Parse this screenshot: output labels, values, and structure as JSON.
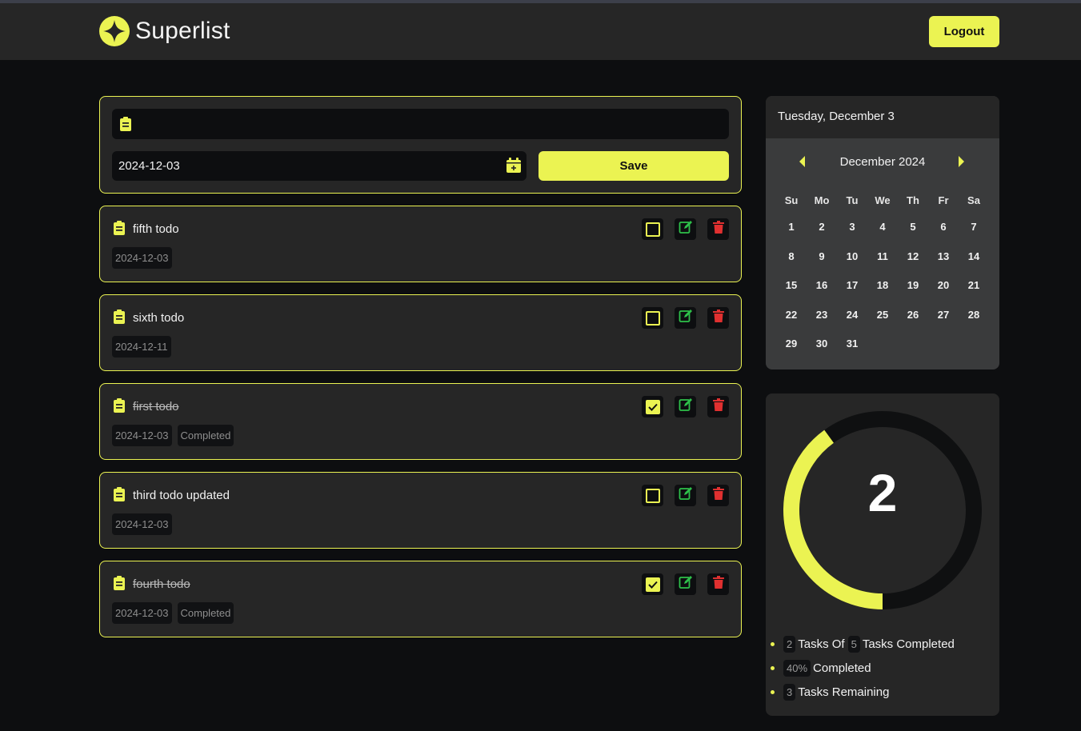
{
  "app": {
    "name": "Superlist",
    "logout_label": "Logout"
  },
  "colors": {
    "accent": "#ebf352",
    "edit": "#2ec04a",
    "delete": "#e03030",
    "background": "#0d0e10",
    "card": "#262626"
  },
  "form": {
    "title_value": "",
    "date_value": "2024-12-03",
    "save_label": "Save"
  },
  "todos": [
    {
      "title": "fifth todo",
      "date": "2024-12-03",
      "completed": false,
      "status": ""
    },
    {
      "title": "sixth todo",
      "date": "2024-12-11",
      "completed": false,
      "status": ""
    },
    {
      "title": "first todo",
      "date": "2024-12-03",
      "completed": true,
      "status": "Completed"
    },
    {
      "title": "third todo updated",
      "date": "2024-12-03",
      "completed": false,
      "status": ""
    },
    {
      "title": "fourth todo",
      "date": "2024-12-03",
      "completed": true,
      "status": "Completed"
    }
  ],
  "calendar": {
    "header_date": "Tuesday, December 3",
    "month_label": "December 2024",
    "weekdays": [
      "Su",
      "Mo",
      "Tu",
      "We",
      "Th",
      "Fr",
      "Sa"
    ],
    "weeks": [
      [
        "1",
        "2",
        "3",
        "4",
        "5",
        "6",
        "7"
      ],
      [
        "8",
        "9",
        "10",
        "11",
        "12",
        "13",
        "14"
      ],
      [
        "15",
        "16",
        "17",
        "18",
        "19",
        "20",
        "21"
      ],
      [
        "22",
        "23",
        "24",
        "25",
        "26",
        "27",
        "28"
      ],
      [
        "29",
        "30",
        "31",
        "",
        "",
        "",
        ""
      ]
    ]
  },
  "stats": {
    "completed_count": "2",
    "total_count": "5",
    "progress_fraction": 0.4,
    "percent_label": "40%",
    "remaining_count": "3",
    "tasks_of_label": "Tasks Of",
    "tasks_completed_label": "Tasks Completed",
    "completed_label": "Completed",
    "tasks_remaining_label": "Tasks Remaining"
  }
}
